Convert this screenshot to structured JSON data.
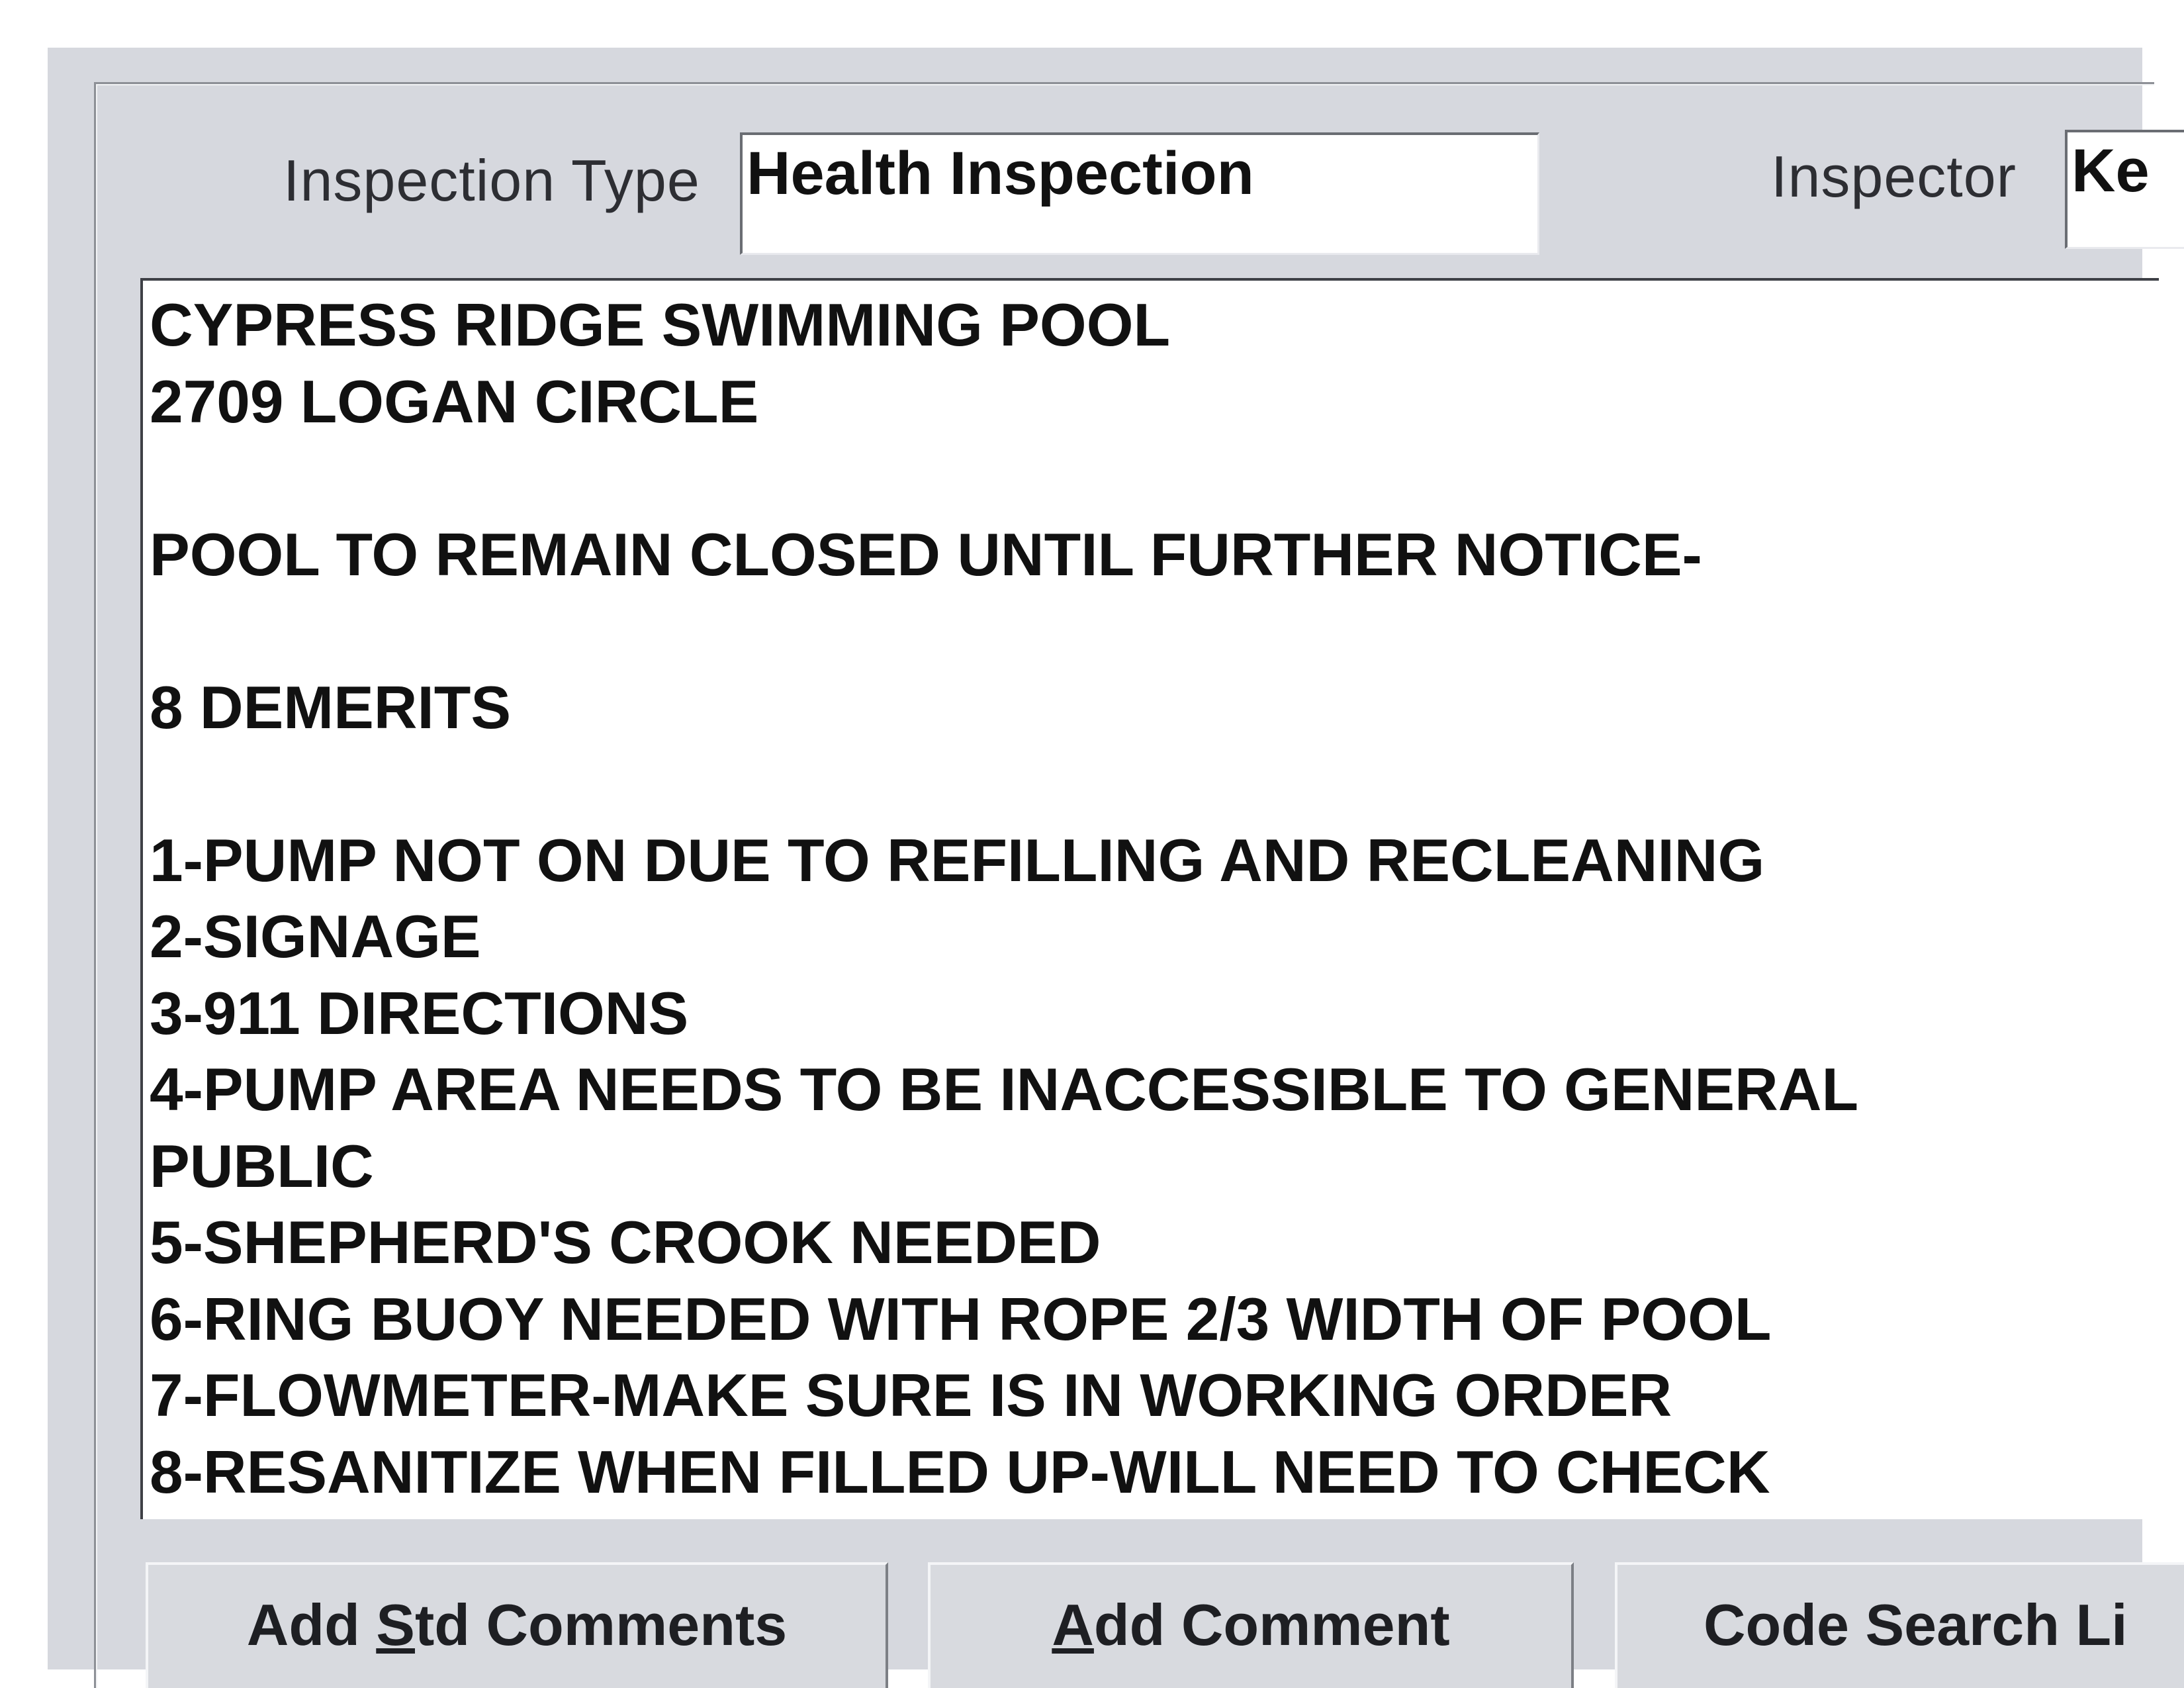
{
  "form": {
    "inspection_type_label": "Inspection Type",
    "inspection_type_value": "Health Inspection",
    "inspector_label": "Inspector",
    "inspector_value": "Ke"
  },
  "comments": {
    "lines": [
      "CYPRESS RIDGE SWIMMING POOL",
      "2709 LOGAN CIRCLE",
      "",
      "POOL TO REMAIN CLOSED UNTIL FURTHER NOTICE-",
      "",
      "8 DEMERITS",
      "",
      "1-PUMP NOT ON DUE TO REFILLING AND RECLEANING",
      "2-SIGNAGE",
      "3-911 DIRECTIONS",
      "4-PUMP AREA NEEDS TO BE INACCESSIBLE TO GENERAL",
      "PUBLIC",
      "5-SHEPHERD'S CROOK NEEDED",
      "6-RING BUOY NEEDED WITH ROPE 2/3 WIDTH OF POOL",
      "7-FLOWMETER-MAKE SURE IS IN WORKING ORDER",
      "8-RESANITIZE WHEN FILLED UP-WILL NEED TO CHECK"
    ]
  },
  "buttons": {
    "add_std_comments": {
      "before": "Add ",
      "mnemonic": "S",
      "after": "td Comments"
    },
    "add_comment": {
      "before": "",
      "mnemonic": "A",
      "after": "dd Comment"
    },
    "code_search": {
      "before": "Code Search Li",
      "mnemonic": "",
      "after": ""
    }
  }
}
